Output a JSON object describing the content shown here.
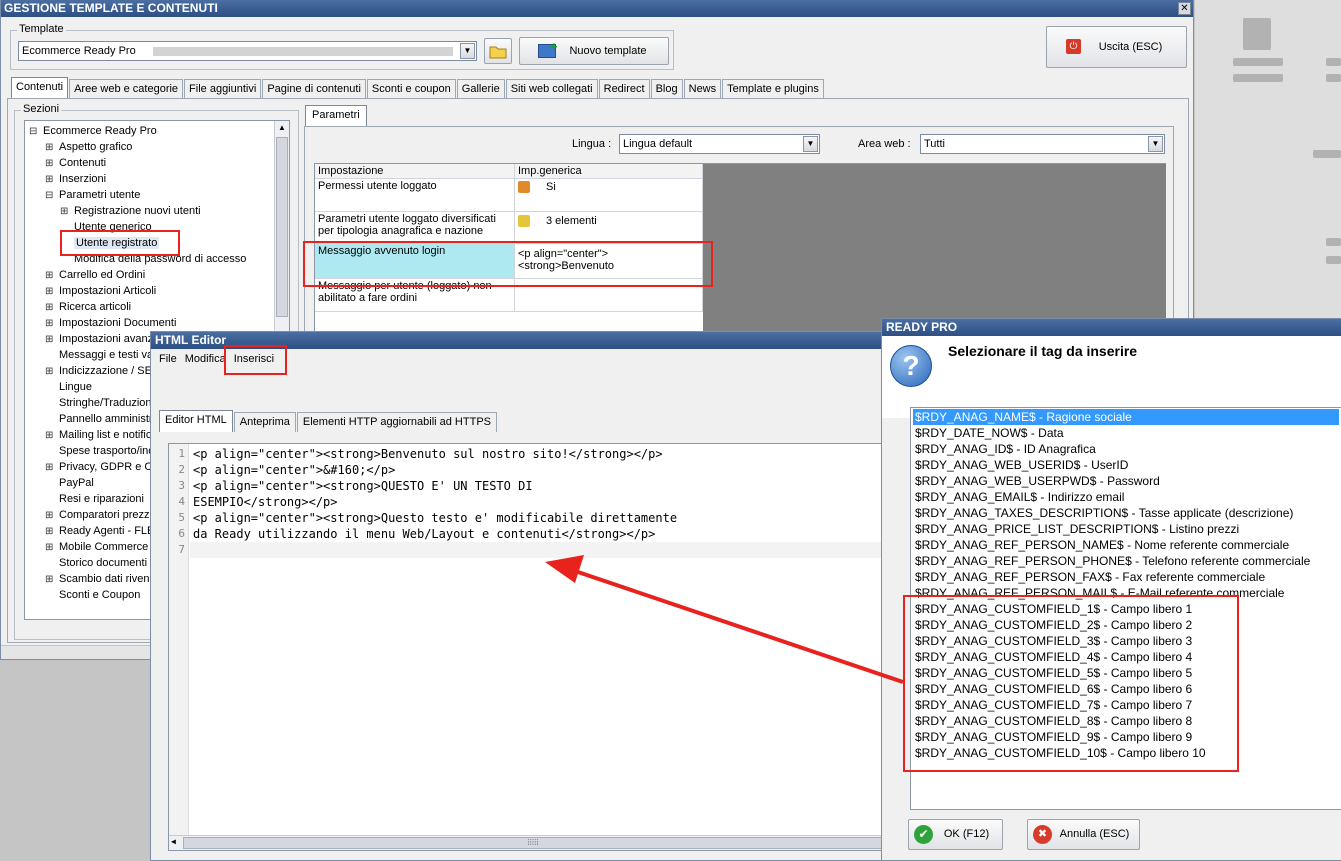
{
  "main": {
    "title": "GESTIONE TEMPLATE E CONTENUTI",
    "close_glyph": "✕",
    "template_label": "Template",
    "template_value": "Ecommerce Ready Pro",
    "folder_icon": "folder-icon",
    "new_template_label": "Nuovo template",
    "exit_label": "Uscita (ESC)",
    "tabs": [
      {
        "label": "Contenuti",
        "active": true
      },
      {
        "label": "Aree web e categorie"
      },
      {
        "label": "File aggiuntivi"
      },
      {
        "label": "Pagine di contenuti"
      },
      {
        "label": "Sconti e coupon"
      },
      {
        "label": "Gallerie"
      },
      {
        "label": "Siti web collegati"
      },
      {
        "label": "Redirect"
      },
      {
        "label": "Blog"
      },
      {
        "label": "News"
      },
      {
        "label": "Template e plugins"
      }
    ],
    "sections_label": "Sezioni",
    "tree": [
      {
        "label": "Ecommerce Ready Pro",
        "exp": "⊟",
        "level": 0
      },
      {
        "label": "Aspetto grafico",
        "exp": "⊞",
        "level": 1
      },
      {
        "label": "Contenuti",
        "exp": "⊞",
        "level": 1
      },
      {
        "label": "Inserzioni",
        "exp": "⊞",
        "level": 1
      },
      {
        "label": "Parametri utente",
        "exp": "⊟",
        "level": 1
      },
      {
        "label": "Registrazione nuovi utenti",
        "exp": "⊞",
        "level": 2
      },
      {
        "label": "Utente generico",
        "exp": "",
        "level": 2
      },
      {
        "label": "Utente registrato",
        "exp": "",
        "level": 2,
        "selected": true
      },
      {
        "label": "Modifica della password di accesso",
        "exp": "",
        "level": 2
      },
      {
        "label": "Carrello ed Ordini",
        "exp": "⊞",
        "level": 1
      },
      {
        "label": "Impostazioni Articoli",
        "exp": "⊞",
        "level": 1
      },
      {
        "label": "Ricerca articoli",
        "exp": "⊞",
        "level": 1
      },
      {
        "label": "Impostazioni Documenti",
        "exp": "⊞",
        "level": 1
      },
      {
        "label": "Impostazioni avanzate",
        "exp": "⊞",
        "level": 1
      },
      {
        "label": "Messaggi e testi vari",
        "exp": "",
        "level": 1
      },
      {
        "label": "Indicizzazione / SEO",
        "exp": "⊞",
        "level": 1
      },
      {
        "label": "Lingue",
        "exp": "",
        "level": 1
      },
      {
        "label": "Stringhe/Traduzioni",
        "exp": "",
        "level": 1
      },
      {
        "label": "Pannello amministrazione",
        "exp": "",
        "level": 1
      },
      {
        "label": "Mailing list e notifiche",
        "exp": "⊞",
        "level": 1
      },
      {
        "label": "Spese trasporto/incasso",
        "exp": "",
        "level": 1
      },
      {
        "label": "Privacy, GDPR e Cookie",
        "exp": "⊞",
        "level": 1
      },
      {
        "label": "PayPal",
        "exp": "",
        "level": 1
      },
      {
        "label": "Resi e riparazioni",
        "exp": "",
        "level": 1
      },
      {
        "label": "Comparatori prezzi",
        "exp": "⊞",
        "level": 1
      },
      {
        "label": "Ready Agenti - FLEX",
        "exp": "⊞",
        "level": 1
      },
      {
        "label": "Mobile Commerce",
        "exp": "⊞",
        "level": 1
      },
      {
        "label": "Storico documenti",
        "exp": "",
        "level": 1
      },
      {
        "label": "Scambio dati rivenditori",
        "exp": "⊞",
        "level": 1
      },
      {
        "label": "Sconti e Coupon",
        "exp": "",
        "level": 1
      }
    ],
    "params_tab": "Parametri",
    "lingua_label": "Lingua :",
    "lingua_value": "Lingua default",
    "area_label": "Area web :",
    "area_value": "Tutti",
    "grid_headers": [
      "Impostazione",
      "Imp.generica"
    ],
    "grid_rows": [
      {
        "name": "Permessi utente loggato",
        "value": "Si"
      },
      {
        "name": "Parametri utente loggato diversificati per tipologia anagrafica e nazione",
        "value": "3 elementi"
      },
      {
        "name": "Messaggio avvenuto login",
        "value": "<p align=\"center\"><strong>Benvenuto"
      },
      {
        "name": "Messaggio per utente (loggato) non abilitato a fare ordini",
        "value": ""
      }
    ]
  },
  "editor": {
    "title": "HTML Editor",
    "menu": [
      "File",
      "Modifica",
      "Inserisci"
    ],
    "tabs": [
      {
        "label": "Editor HTML",
        "active": true
      },
      {
        "label": "Anteprima"
      },
      {
        "label": "Elementi HTTP aggiornabili ad HTTPS"
      }
    ],
    "lines": [
      {
        "n": "1",
        "text": "<p align=\"center\"><strong>Benvenuto sul nostro sito!</strong></p>"
      },
      {
        "n": "2",
        "text": "<p align=\"center\">&#160;</p>"
      },
      {
        "n": "3",
        "text": "<p align=\"center\"><strong>QUESTO E' UN TESTO DI"
      },
      {
        "n": "4",
        "text": "ESEMPIO</strong></p>"
      },
      {
        "n": "5",
        "text": "<p align=\"center\"><strong>Questo testo e' modificabile direttamente"
      },
      {
        "n": "6",
        "text": "da Ready utilizzando il menu Web/Layout e contenuti</strong></p>"
      },
      {
        "n": "7",
        "text": ""
      }
    ],
    "hscroll_thumb": "⁞⁞⁞⁞⁞"
  },
  "dialog": {
    "title": "READY PRO",
    "question_glyph": "?",
    "heading": "Selezionare il tag da inserire",
    "items": [
      {
        "tag": "$RDY_ANAG_NAME$",
        "desc": "Ragione sociale",
        "selected": true
      },
      {
        "tag": "$RDY_DATE_NOW$",
        "desc": "Data"
      },
      {
        "tag": "$RDY_ANAG_ID$",
        "desc": "ID Anagrafica"
      },
      {
        "tag": "$RDY_ANAG_WEB_USERID$",
        "desc": "UserID"
      },
      {
        "tag": "$RDY_ANAG_WEB_USERPWD$",
        "desc": "Password"
      },
      {
        "tag": "$RDY_ANAG_EMAIL$",
        "desc": "Indirizzo email"
      },
      {
        "tag": "$RDY_ANAG_TAXES_DESCRIPTION$",
        "desc": "Tasse applicate (descrizione)"
      },
      {
        "tag": "$RDY_ANAG_PRICE_LIST_DESCRIPTION$",
        "desc": "Listino prezzi"
      },
      {
        "tag": "$RDY_ANAG_REF_PERSON_NAME$",
        "desc": "Nome referente commerciale"
      },
      {
        "tag": "$RDY_ANAG_REF_PERSON_PHONE$",
        "desc": "Telefono referente commerciale"
      },
      {
        "tag": "$RDY_ANAG_REF_PERSON_FAX$",
        "desc": "Fax referente commerciale"
      },
      {
        "tag": "$RDY_ANAG_REF_PERSON_MAIL$",
        "desc": "E-Mail referente commerciale"
      },
      {
        "tag": "$RDY_ANAG_CUSTOMFIELD_1$",
        "desc": "Campo libero 1"
      },
      {
        "tag": "$RDY_ANAG_CUSTOMFIELD_2$",
        "desc": "Campo libero 2"
      },
      {
        "tag": "$RDY_ANAG_CUSTOMFIELD_3$",
        "desc": "Campo libero 3"
      },
      {
        "tag": "$RDY_ANAG_CUSTOMFIELD_4$",
        "desc": "Campo libero 4"
      },
      {
        "tag": "$RDY_ANAG_CUSTOMFIELD_5$",
        "desc": "Campo libero 5"
      },
      {
        "tag": "$RDY_ANAG_CUSTOMFIELD_6$",
        "desc": "Campo libero 6"
      },
      {
        "tag": "$RDY_ANAG_CUSTOMFIELD_7$",
        "desc": "Campo libero 7"
      },
      {
        "tag": "$RDY_ANAG_CUSTOMFIELD_8$",
        "desc": "Campo libero 8"
      },
      {
        "tag": "$RDY_ANAG_CUSTOMFIELD_9$",
        "desc": "Campo libero 9"
      },
      {
        "tag": "$RDY_ANAG_CUSTOMFIELD_10$",
        "desc": "Campo libero 10"
      }
    ],
    "separator": " - ",
    "ok_label": "OK (F12)",
    "cancel_label": "Annulla (ESC)",
    "ok_glyph": "✔",
    "cancel_glyph": "✖"
  },
  "colors": {
    "highlight": "#e8231e",
    "selection": "#3399ff",
    "titlebar": "#2d4f83"
  }
}
